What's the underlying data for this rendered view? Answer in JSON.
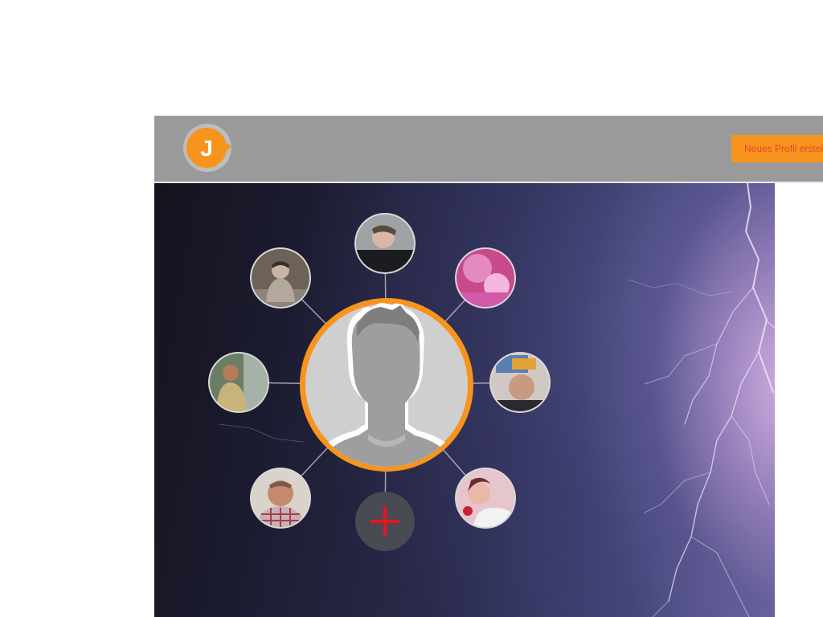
{
  "header": {
    "logo_letter": "J",
    "new_profile_label": "Neues Profil erstellen"
  },
  "profile": {
    "main_avatar_icon": "person-silhouette-icon",
    "add_icon": "plus-icon",
    "friends": [
      {
        "name": "friend-photo-1"
      },
      {
        "name": "friend-photo-2"
      },
      {
        "name": "friend-photo-3"
      },
      {
        "name": "friend-photo-4"
      },
      {
        "name": "friend-photo-5"
      },
      {
        "name": "friend-photo-6"
      },
      {
        "name": "friend-photo-7"
      }
    ]
  },
  "colors": {
    "header_bg": "#9a9a9a",
    "accent": "#f7941d",
    "button_text": "#e9442b",
    "add_button_bg": "#4a4a52",
    "add_icon": "#e8141e"
  }
}
